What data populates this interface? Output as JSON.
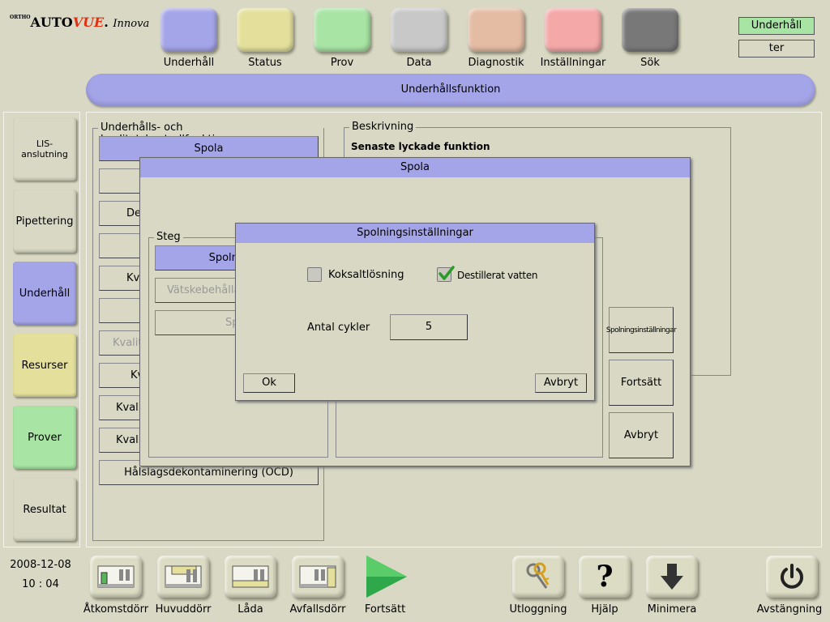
{
  "logo": {
    "ortho": "ORTHO",
    "auto": "AUTO",
    "vue": "VUE",
    "innova": "Innova"
  },
  "colors": {
    "maintenance": "#a4a4e8",
    "status": "#e4e09c",
    "samples": "#a8e4a4",
    "data": "#c8c8c8",
    "diagnostics": "#e4bca4",
    "settings": "#f4a8a8",
    "search": "#787878",
    "resources": "#e4e09c",
    "background": "#d8d8c4"
  },
  "top_nav": [
    {
      "label": "Underhåll",
      "color": "#a4a4e8"
    },
    {
      "label": "Status",
      "color": "#e4e09c"
    },
    {
      "label": "Prov",
      "color": "#a8e4a4"
    },
    {
      "label": "Data",
      "color": "#c8c8c8"
    },
    {
      "label": "Diagnostik",
      "color": "#e4bca4"
    },
    {
      "label": "Inställningar",
      "color": "#f4a8a8"
    },
    {
      "label": "Sök",
      "color": "#787878"
    }
  ],
  "mode": {
    "current": "Underhåll",
    "secondary": "ter"
  },
  "banner": "Underhållsfunktion",
  "sidebar": [
    {
      "label": "LIS-anslutning",
      "color": "#d8d8c4"
    },
    {
      "label": "Pipettering",
      "color": "#d8d8c4"
    },
    {
      "label": "Underhåll",
      "color": "#a4a4e8"
    },
    {
      "label": "Resurser",
      "color": "#e4e09c"
    },
    {
      "label": "Prover",
      "color": "#a8e4a4"
    },
    {
      "label": "Resultat",
      "color": "#d8d8c4"
    }
  ],
  "functions": {
    "legend": "Underhålls- och kvalitetskontrollfunktioner",
    "items": [
      "Spola",
      "",
      "De",
      "",
      "Kv",
      "",
      "Kvalit",
      "Kv",
      "Kvali",
      "Kvali",
      "Hålslagsdekontaminering (OCD)"
    ]
  },
  "description": {
    "legend": "Beskrivning",
    "heading": "Senaste lyckade funktion"
  },
  "spola_dialog": {
    "title": "Spola",
    "steps_legend": "Steg",
    "steps": [
      "Spolningsi",
      "Vätskebehållar",
      "Sp"
    ],
    "buttons": {
      "settings": "Spolningsinställningar",
      "continue": "Fortsätt",
      "cancel": "Avbryt"
    }
  },
  "settings_dialog": {
    "title": "Spolningsinställningar",
    "saline": {
      "label": "Koksaltlösning",
      "checked": false
    },
    "distilled": {
      "label": "Destillerat vatten",
      "checked": true
    },
    "cycles_label": "Antal cykler",
    "cycles_value": "5",
    "ok": "Ok",
    "cancel": "Avbryt"
  },
  "datetime": {
    "date": "2008-12-08",
    "time": "10 : 04"
  },
  "bottom_bar": {
    "access_door": "Åtkomstdörr",
    "main_door": "Huvuddörr",
    "drawer": "Låda",
    "waste_door": "Avfallsdörr",
    "continue": "Fortsätt",
    "logout": "Utloggning",
    "help": "Hjälp",
    "minimize": "Minimera",
    "shutdown": "Avstängning"
  }
}
